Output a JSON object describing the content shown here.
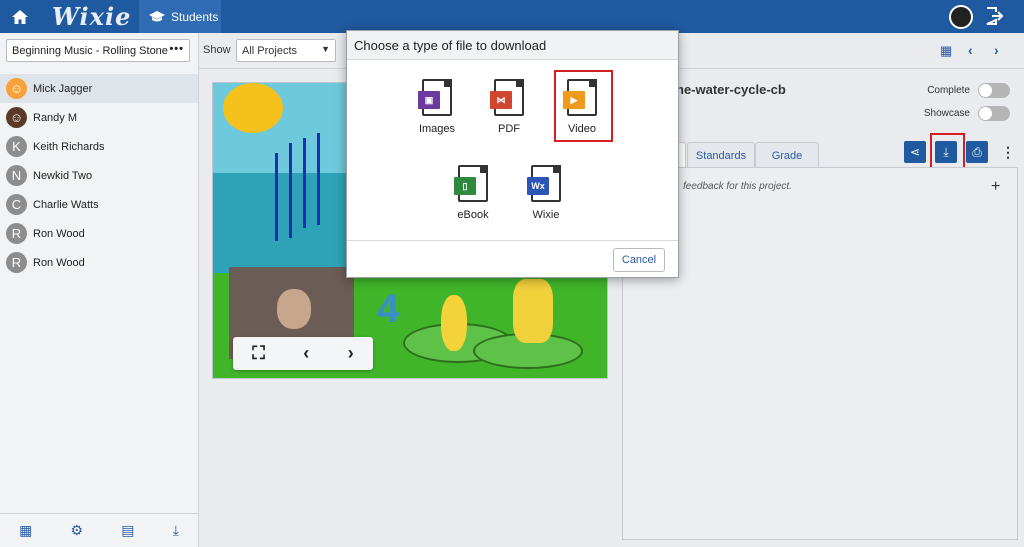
{
  "header": {
    "logo": "Wixie",
    "students_tab": "Students"
  },
  "left": {
    "class_name": "Beginning Music - Rolling Stone",
    "students": [
      {
        "name": "Mick Jagger",
        "initial": ""
      },
      {
        "name": "Randy M",
        "initial": ""
      },
      {
        "name": "Keith Richards",
        "initial": "K"
      },
      {
        "name": "Newkid Two",
        "initial": "N"
      },
      {
        "name": "Charlie Watts",
        "initial": "C"
      },
      {
        "name": "Ron Wood",
        "initial": "R"
      },
      {
        "name": "Ron Wood",
        "initial": "R"
      }
    ]
  },
  "filter": {
    "show_label": "Show",
    "projects_value": "All Projects"
  },
  "project": {
    "title": "he-water-cycle-cb",
    "complete_label": "Complete",
    "showcase_label": "Showcase",
    "tabs": [
      "Standards",
      "Grade"
    ],
    "feedback_text": "feedback for this project."
  },
  "modal": {
    "title": "Choose a type of file to download",
    "options": [
      {
        "label": "Images",
        "badge": "▣",
        "color": "#6a3a9e"
      },
      {
        "label": "PDF",
        "badge": "⋈",
        "color": "#d0452f"
      },
      {
        "label": "Video",
        "badge": "▶",
        "color": "#ef9a1a"
      },
      {
        "label": "eBook",
        "badge": "▯",
        "color": "#2f8a3e"
      },
      {
        "label": "Wixie",
        "badge": "Wx",
        "color": "#2b55b7"
      }
    ],
    "cancel_label": "Cancel"
  }
}
